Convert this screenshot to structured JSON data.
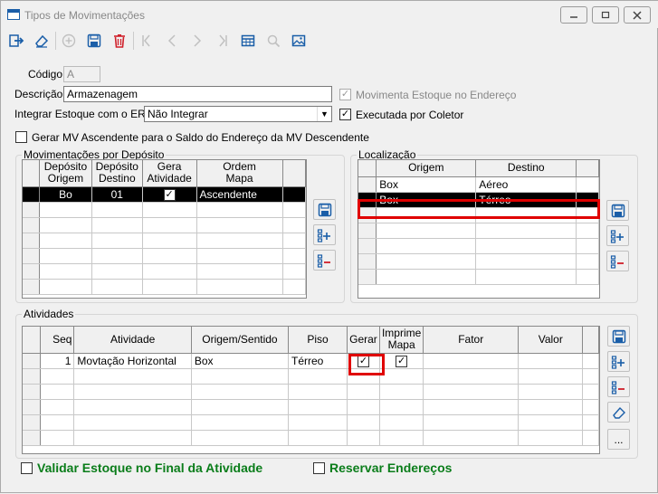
{
  "window": {
    "title": "Tipos de Movimentações"
  },
  "form": {
    "codigo_label": "Código",
    "codigo_value": "A",
    "descricao_label": "Descrição",
    "descricao_value": "Armazenagem",
    "integrar_label": "Integrar Estoque com o ERP",
    "integrar_value": "Não Integrar",
    "movimenta_label": "Movimenta Estoque no Endereço",
    "executada_label": "Executada por Coletor",
    "gerar_mv_label": "Gerar MV Ascendente para o Saldo do Endereço da MV Descendente"
  },
  "movimentacoes": {
    "title": "Movimentações por Depósito",
    "headers": [
      "Depósito\nOrigem",
      "Depósito\nDestino",
      "Gera\nAtividade",
      "Ordem\nMapa"
    ],
    "rows": [
      {
        "origem": "Bo",
        "destino": "01",
        "gera": true,
        "ordem": "Ascendente"
      }
    ]
  },
  "localizacao": {
    "title": "Localização",
    "headers": [
      "Origem",
      "Destino"
    ],
    "rows": [
      {
        "origem": "Box",
        "destino": "Aéreo"
      },
      {
        "origem": "Box",
        "destino": "Térreo"
      }
    ]
  },
  "atividades": {
    "title": "Atividades",
    "headers": [
      "Seq",
      "Atividade",
      "Origem/Sentido",
      "Piso",
      "Gerar",
      "Imprime\nMapa",
      "Fator",
      "Valor"
    ],
    "rows": [
      {
        "seq": "1",
        "atividade": "Movtação Horizontal",
        "origem": "Box",
        "piso": "Térreo",
        "gerar": true,
        "imprime": true,
        "fator": "",
        "valor": ""
      }
    ],
    "more_label": "..."
  },
  "footer": {
    "validar_label": "Validar Estoque no Final da Atividade",
    "reservar_label": "Reservar Endereços"
  },
  "colors": {
    "highlight": "#e00000",
    "green_text": "#0a7d1a",
    "selected_row": "#000000"
  }
}
